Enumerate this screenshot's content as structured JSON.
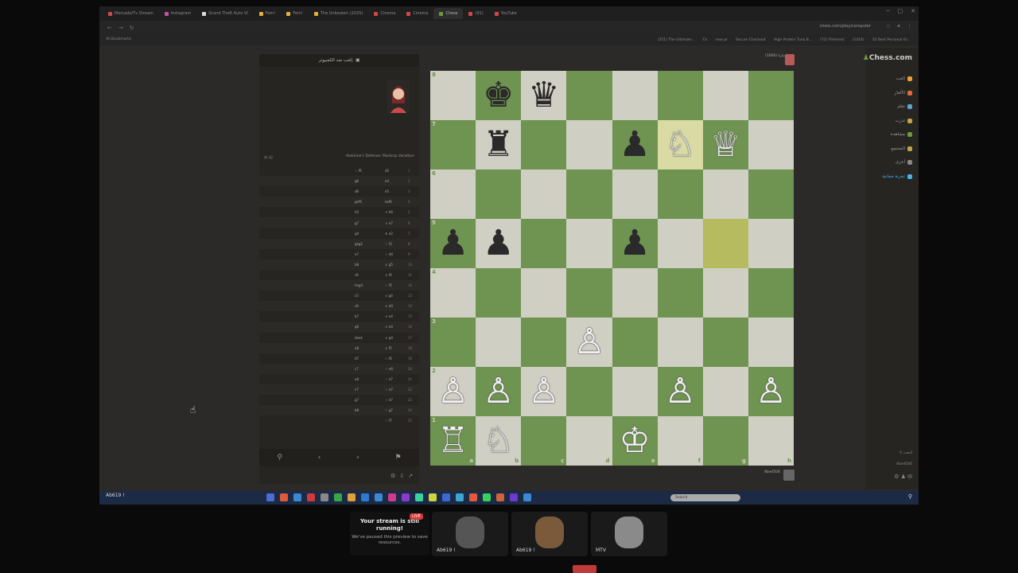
{
  "browser": {
    "tabs": [
      {
        "label": "Mercado/Tv Stream",
        "color": "#c94d4d",
        "active": false
      },
      {
        "label": "Instagram",
        "color": "#c84ca8",
        "active": false
      },
      {
        "label": "Grand Theft Auto VI",
        "color": "#d9d9d9",
        "active": false
      },
      {
        "label": "Fem!",
        "color": "#e3b23c",
        "active": false
      },
      {
        "label": "Fem!",
        "color": "#e3b23c",
        "active": false
      },
      {
        "label": "The Unbeaten (2025)",
        "color": "#e3b23c",
        "active": false
      },
      {
        "label": "Cinema",
        "color": "#d64545",
        "active": false
      },
      {
        "label": "Cinema",
        "color": "#d64545",
        "active": false
      },
      {
        "label": "Chess",
        "color": "#6b9a3a",
        "active": true
      },
      {
        "label": "(91)",
        "color": "#d64545",
        "active": false
      },
      {
        "label": "YouTube",
        "color": "#d64545",
        "active": false
      }
    ],
    "url": "chess.com/play/computer",
    "all_bookmarks_label": "All Bookmarks",
    "bookmarks": [
      "(251) The Ultimate...",
      "Ck",
      "new pr",
      "Secure Checkout",
      "High Protein Tuna B...",
      "(72) Pinterest",
      "(1418)",
      "10 Best Personal Gr..."
    ]
  },
  "rail": {
    "logo": "Chess.com",
    "items": [
      {
        "label": "العب",
        "color": "#e9a23b"
      },
      {
        "label": "الألغاز",
        "color": "#e36b3a"
      },
      {
        "label": "تعلم",
        "color": "#5aa6d6"
      },
      {
        "label": "تدرب",
        "color": "#c6a24a"
      },
      {
        "label": "مشاهدة",
        "color": "#6b9a3a"
      },
      {
        "label": "المجتمع",
        "color": "#c6a24a"
      },
      {
        "label": "أخرى",
        "color": "#888888"
      },
      {
        "label": "تجربة مجانية",
        "color": "#4ab3e6"
      }
    ],
    "search_label": "البحث",
    "user": "Abed506"
  },
  "panel": {
    "title": "إلعب ضد الكمبيوتر",
    "opening": "Alekhine's Defense: Maróczy Variation",
    "moves": [
      {
        "n": "1",
        "w": "d3",
        "b": "♘ f6"
      },
      {
        "n": "2",
        "w": "e4",
        "b": "g6"
      },
      {
        "n": "3",
        "w": "e5",
        "b": "d6"
      },
      {
        "n": "4",
        "w": "exf6",
        "b": "gxf6"
      },
      {
        "n": "5",
        "w": "♗ h6",
        "b": "h5"
      },
      {
        "n": "6",
        "w": "♗ e7",
        "b": "g7"
      },
      {
        "n": "7",
        "w": "♔ e2",
        "b": "g4"
      },
      {
        "n": "8",
        "w": "♘ f3",
        "b": "gxg2"
      },
      {
        "n": "9",
        "w": "♘ d4",
        "b": "e7"
      },
      {
        "n": "10",
        "w": "♕ g5",
        "b": "b8"
      },
      {
        "n": "11",
        "w": "♕ f4",
        "b": "c6"
      },
      {
        "n": "12",
        "w": "♘ f5",
        "b": "hxg4"
      },
      {
        "n": "13",
        "w": "♕ g4",
        "b": "c5"
      },
      {
        "n": "14",
        "w": "♕ d4",
        "b": "c6"
      },
      {
        "n": "15",
        "w": "♕ e4",
        "b": "b7"
      },
      {
        "n": "16",
        "w": "♕ e4",
        "b": "g6"
      },
      {
        "n": "17",
        "w": "♕ g4",
        "b": "dxe4"
      },
      {
        "n": "18",
        "w": "♕ f5",
        "b": "a8"
      },
      {
        "n": "19",
        "w": "♘ f6",
        "b": "d7"
      },
      {
        "n": "20",
        "w": "♘ e6",
        "b": "c7"
      },
      {
        "n": "21",
        "w": "♘ e7",
        "b": "e8"
      },
      {
        "n": "22",
        "w": "♘ e7",
        "b": "c7"
      },
      {
        "n": "23",
        "w": "♘ e7",
        "b": "g7"
      },
      {
        "n": "24",
        "w": "♘ g7",
        "b": "b8"
      },
      {
        "n": "25",
        "w": "♘ f7",
        "b": ""
      }
    ],
    "controls": [
      "⚲",
      "‹",
      "›",
      "⚑"
    ],
    "tools": [
      "⚙",
      "⇩",
      "↗"
    ]
  },
  "board": {
    "ranks": [
      "8",
      "7",
      "6",
      "5",
      "4",
      "3",
      "2",
      "1"
    ],
    "files": [
      "a",
      "b",
      "c",
      "d",
      "e",
      "f",
      "g",
      "h"
    ],
    "highlight": [
      "f7",
      "g5"
    ],
    "pieces": {
      "b8": "♚",
      "c8": "♛",
      "b7": "♜",
      "e7": "♟",
      "f7": "♘",
      "g7": "♕",
      "a5": "♟",
      "b5": "♟",
      "e5": "♟",
      "d3": "♙",
      "a2": "♙",
      "b2": "♙",
      "c2": "♙",
      "f2": "♙",
      "h2": "♙",
      "a1": "♖",
      "b1": "♘",
      "e1": "♔"
    }
  },
  "players": {
    "opponent": "مارتا (1000)",
    "me": "Abed506"
  },
  "taskbar": {
    "weather": "Ab619 !",
    "search": "Search",
    "app_colors": [
      "#4a6fd1",
      "#e05a3a",
      "#3a8ad1",
      "#d13a3a",
      "#888",
      "#3aa64a",
      "#e0a03a",
      "#2f7ad1",
      "#3a8ad1",
      "#d13a8a",
      "#8a3ad1",
      "#3ad1a0",
      "#d1d13a",
      "#3a6ad1",
      "#3aa6d1",
      "#e05a3a",
      "#3ad15a",
      "#d1623a",
      "#6a3ad1",
      "#3a8ad1"
    ]
  },
  "stream": {
    "live": "LIVE",
    "title": "Your stream is still running!",
    "body": "We've paused this preview to save resources.",
    "thumbs": [
      {
        "caption": "Ab619 !",
        "color": "#555"
      },
      {
        "caption": "Ab619 !",
        "color": "#7a5a3a"
      },
      {
        "caption": "MTV",
        "color": "#8a8a8a"
      }
    ]
  }
}
